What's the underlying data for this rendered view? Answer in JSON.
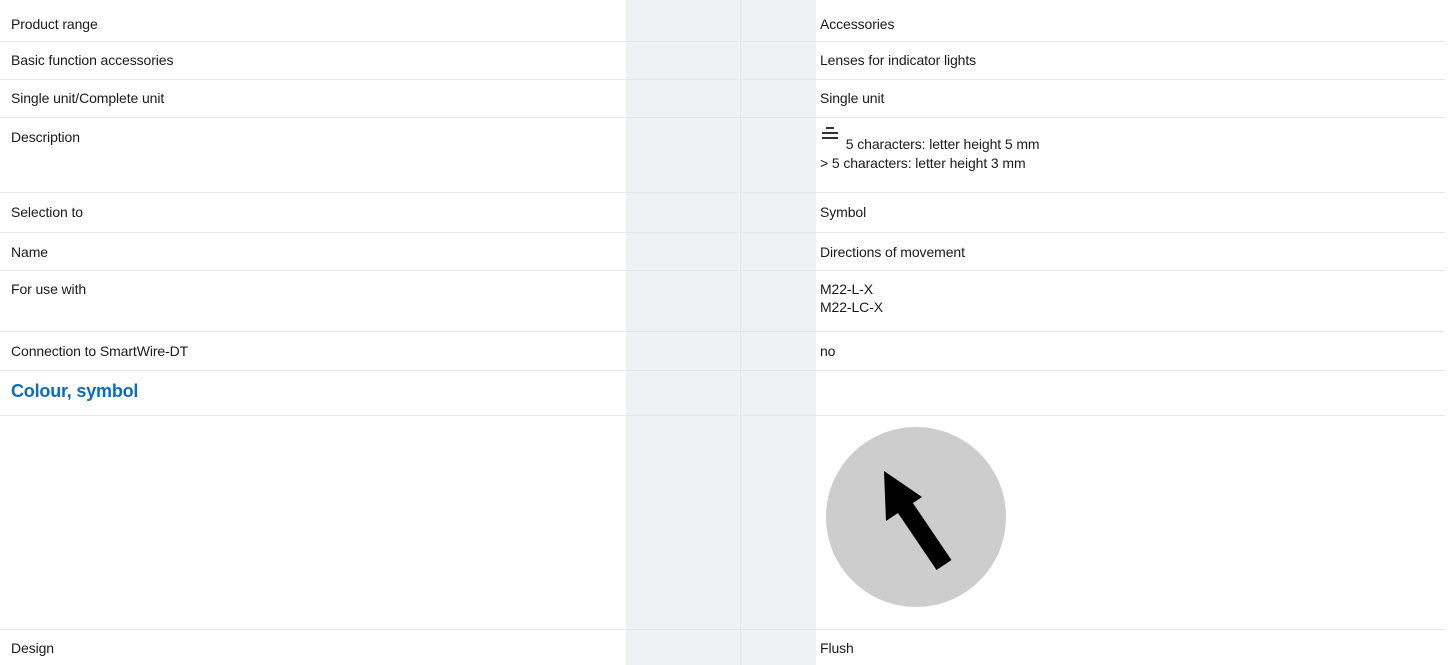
{
  "rows": [
    {
      "label": "Product range",
      "value": "Accessories"
    },
    {
      "label": "Basic function accessories",
      "value": "Lenses for indicator lights"
    },
    {
      "label": "Single unit/Complete unit",
      "value": "Single unit"
    },
    {
      "label": "Description",
      "value_lines": [
        "5 characters: letter height 5 mm",
        "> 5 characters: letter height 3 mm"
      ],
      "icon": "text-lines-icon"
    },
    {
      "label": "Selection to",
      "value": "Symbol"
    },
    {
      "label": "Name",
      "value": "Directions of movement"
    },
    {
      "label": "For use with",
      "value_lines": [
        "M22-L-X",
        "M22-LC-X"
      ]
    },
    {
      "label": "Connection to SmartWire-DT",
      "value": "no"
    }
  ],
  "section": {
    "title": "Colour, symbol"
  },
  "symbol": {
    "icon": "arrow-up-left-icon",
    "background_color": "#cdcdcd",
    "arrow_color": "#000000"
  },
  "design": {
    "label": "Design",
    "value": "Flush"
  },
  "colors": {
    "accent": "#0b6cb8",
    "band": "#eff1f4"
  }
}
